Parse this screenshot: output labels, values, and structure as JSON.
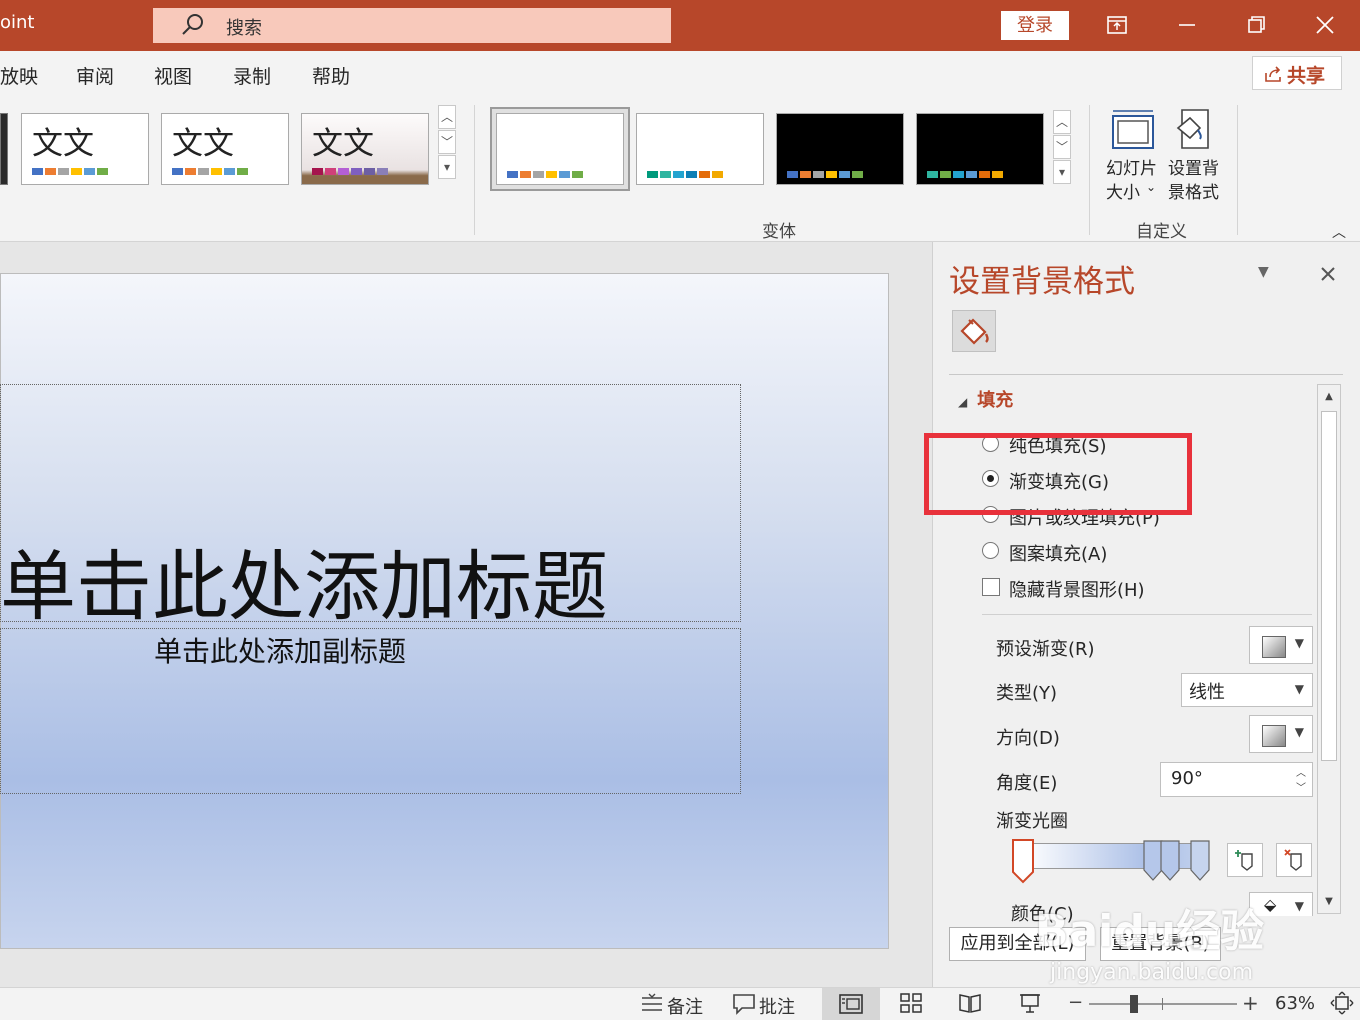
{
  "titlebar": {
    "app_name": "oint",
    "search_placeholder": "搜索",
    "login_label": "登录"
  },
  "menu": {
    "items": [
      "放映",
      "审阅",
      "视图",
      "录制",
      "帮助"
    ],
    "share_label": "共享"
  },
  "ribbon": {
    "theme_text": "文文",
    "variants_group_label": "变体",
    "customize_group_label": "自定义",
    "slide_size_label_1": "幻灯片",
    "slide_size_label_2": "大小",
    "format_bg_label_1": "设置背",
    "format_bg_label_2": "景格式"
  },
  "slide": {
    "title_text": "单击此处添加标题",
    "subtitle_text": "单击此处添加副标题"
  },
  "pane": {
    "title": "设置背景格式",
    "fill_section_label": "填充",
    "options": {
      "solid": "纯色填充(S)",
      "gradient": "渐变填充(G)",
      "picture": "图片或纹理填充(P)",
      "pattern": "图案填充(A)",
      "hide_graphics": "隐藏背景图形(H)"
    },
    "preset_label": "预设渐变(R)",
    "type_label": "类型(Y)",
    "type_value": "线性",
    "direction_label": "方向(D)",
    "angle_label": "角度(E)",
    "angle_value": "90°",
    "stops_label": "渐变光圈",
    "color_label": "颜色(C)",
    "apply_all_label": "应用到全部(L)",
    "reset_label": "重置背景(B)"
  },
  "statusbar": {
    "notes_label": "备注",
    "comments_label": "批注",
    "zoom_value": "63%"
  },
  "watermark": {
    "text": "Baidu经验",
    "url": "jingyan.baidu.com"
  },
  "colors": {
    "accent": "#b7472a",
    "highlight": "#e8313b"
  }
}
